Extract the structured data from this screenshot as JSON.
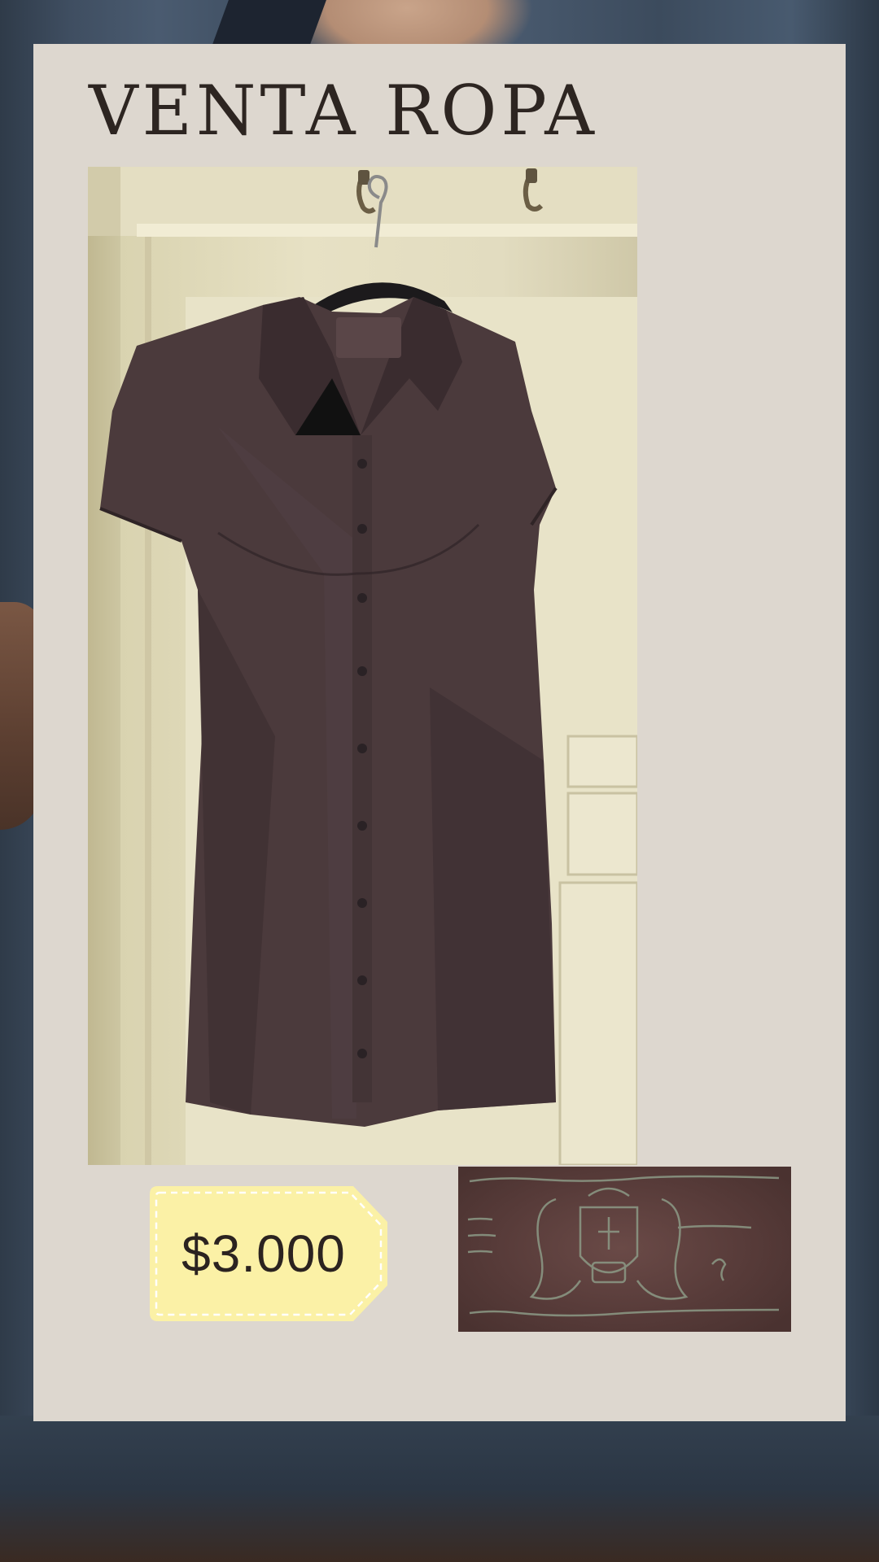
{
  "card": {
    "title": "VENTA ROPA"
  },
  "product": {
    "price": "$3.000",
    "photo_icon": "shirt-on-hanger",
    "label_icon": "garment-label"
  },
  "colors": {
    "card_background": "#ddd7cf",
    "title_text": "#2d2521",
    "price_tag_fill": "#fbf1a6",
    "shirt": "#4a3a3a"
  }
}
